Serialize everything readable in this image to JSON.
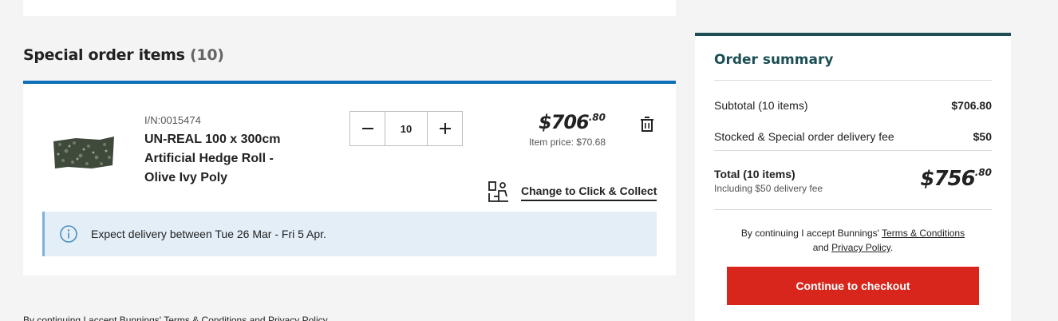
{
  "special_order": {
    "title": "Special order items",
    "count": "(10)"
  },
  "item": {
    "item_number": "I/N:0015474",
    "name": "UN-REAL 100 x 300cm Artificial Hedge Roll - Olive Ivy Poly",
    "quantity": "10",
    "price_dollars": "$706",
    "price_cents": ".80",
    "item_price": "Item price: $70.68",
    "change_link": "Change to Click & Collect",
    "delivery_message": "Expect delivery between Tue 26 Mar - Fri 5 Apr."
  },
  "bottom_terms": {
    "prefix": "By continuing I accept Bunnings' ",
    "terms_link": "Terms & Conditions",
    "and": " and ",
    "privacy_link": "Privacy Policy"
  },
  "summary": {
    "title": "Order summary",
    "subtotal_label": "Subtotal (10 items)",
    "subtotal_value": "$706.80",
    "delivery_label": "Stocked & Special order delivery fee",
    "delivery_value": "$50",
    "total_label": "Total (10 items)",
    "total_sub": "Including $50 delivery fee",
    "total_dollars": "$756",
    "total_cents": ".80",
    "terms_prefix": "By continuing I accept Bunnings' ",
    "terms_link": "Terms & Conditions",
    "terms_and": "and ",
    "privacy_link": "Privacy Policy",
    "terms_end": ".",
    "checkout_label": "Continue to checkout"
  },
  "colors": {
    "accent_blue": "#0d6fb8",
    "summary_teal": "#1c4f53",
    "checkout_red": "#d9261c",
    "info_bg": "#e3eef6"
  },
  "icons": [
    "minus-icon",
    "plus-icon",
    "trash-icon",
    "click-collect-icon",
    "info-icon"
  ]
}
